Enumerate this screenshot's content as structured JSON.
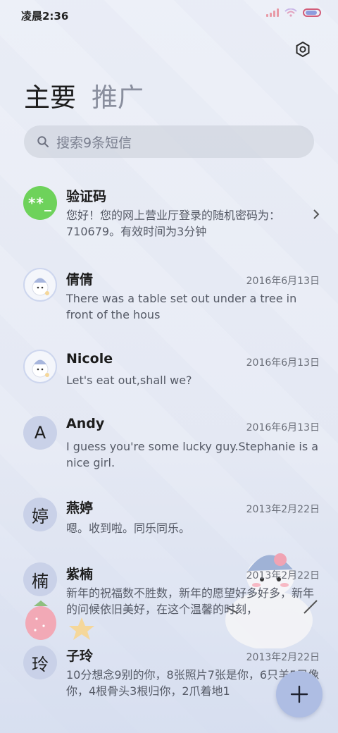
{
  "status_bar": {
    "time": "凌晨2:36"
  },
  "tabs": [
    {
      "label": "主要",
      "active": true
    },
    {
      "label": "推广",
      "active": false
    }
  ],
  "search": {
    "placeholder": "搜索9条短信"
  },
  "conversations": [
    {
      "name": "验证码",
      "avatar_text": "**_",
      "avatar_type": "code",
      "date": "",
      "preview": "您好！您的网上营业厅登录的随机密码为：710679。有效时间为3分钟"
    },
    {
      "name": "倩倩",
      "avatar_text": "",
      "avatar_type": "picture",
      "date": "2016年6月13日",
      "preview": "There was a table set out under a tree in front of the hous"
    },
    {
      "name": "Nicole",
      "avatar_text": "",
      "avatar_type": "picture",
      "date": "2016年6月13日",
      "preview": "Let's eat out,shall we?"
    },
    {
      "name": "Andy",
      "avatar_text": "A",
      "avatar_type": "letter",
      "date": "2016年6月13日",
      "preview": "I guess you're some lucky guy.Stephanie is a nice girl."
    },
    {
      "name": "燕婷",
      "avatar_text": "婷",
      "avatar_type": "letter",
      "date": "2013年2月22日",
      "preview": "嗯。收到啦。同乐同乐。"
    },
    {
      "name": "紫楠",
      "avatar_text": "楠",
      "avatar_type": "letter",
      "date": "2013年2月22日",
      "preview": "新年的祝福数不胜数，新年的愿望好多好多，新年的问候依旧美好，在这个温馨的时刻，"
    },
    {
      "name": "子玲",
      "avatar_text": "玲",
      "avatar_type": "letter",
      "date": "2013年2月22日",
      "preview": "10分想念9别的你，8张照片7张是你，6只羊5只像你，4根骨头3根归你，2爪着地1"
    }
  ],
  "colors": {
    "code_avatar": "#6ed25b",
    "letter_avatar": "#c9d1e8",
    "fab": "#aebde3"
  },
  "icons": {
    "settings": "gear-icon",
    "search": "search-icon",
    "compose": "plus-icon",
    "chevron": "chevron-right-icon"
  }
}
